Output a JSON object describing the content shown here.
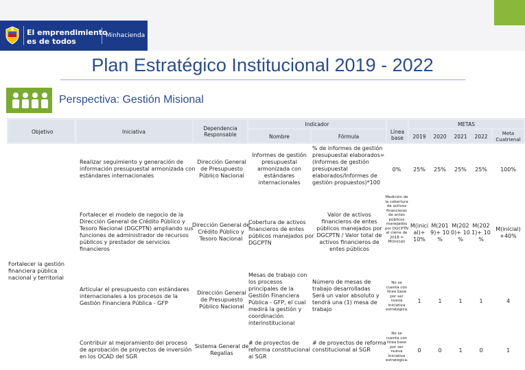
{
  "brand": {
    "line1": "El emprendimiento",
    "line2": "es de todos",
    "ministry": "Minhacienda",
    "bar_color": "#1b3a8a",
    "accent_color": "#8ab83a"
  },
  "title": "Plan Estratégico Institucional 2019 - 2022",
  "perspective": "Perspectiva: Gestión Misional",
  "headers": {
    "objetivo": "Objetivo",
    "iniciativa": "Iniciativa",
    "dependencia": "Dependencia Responsable",
    "indicador": "Indicador",
    "nombre": "Nombre",
    "formula": "Fórmula",
    "linea_base": "Línea base",
    "metas": "METAS",
    "years": [
      "2019",
      "2020",
      "2021",
      "2022"
    ],
    "meta_cuatrienal": "Meta Cuatrienal"
  },
  "objetivo": "Fortalecer la gestión financiera pública nacional y territorial",
  "rows": [
    {
      "iniciativa": "Realizar seguimiento y generación de información presupuestal armonizada con estándares internacionales",
      "dependencia": "Dirección General de Presupuesto Público Nacional",
      "nombre": "Informes de gestión presupuestal armonizada con estándares internacionales",
      "formula": "% de informes de gestión presupuestal elaborados=(Informes de gestión presupuestal elaborados/Informes de gestión propuestos)*100",
      "linea_base": "0%",
      "metas": [
        "25%",
        "25%",
        "25%",
        "25%"
      ],
      "cuatrienal": "100%"
    },
    {
      "iniciativa": "Fortalecer el modelo de negocio de la Dirección General de Crédito Público y Tesoro Nacional (DGCPTN) ampliando sus funciones de administrador de recursos públicos y prestador de servicios financieros",
      "dependencia": "Dirección General de Crédito Público y Tesoro Nacional",
      "nombre": "Cobertura de activos financieros de entes públicos manejados por DGCPTN",
      "formula": "Valor de activos financieros de entes públicos manejados por DGCPTN / Valor total de activos financieros de entes públicos",
      "linea_base": "Medición de la cobertura de activos financieros de entes públicos manejados por DGCPTN al cierre de 2018 = M(inicial)",
      "metas": [
        "M(inici al)+ 10%",
        "M(201 9)+ 10 %",
        "M(202 0)+ 10 %",
        "M(202 1)+ 10 %"
      ],
      "cuatrienal": "M(inicial) +40%"
    },
    {
      "iniciativa": "Articular el presupuesto con estándares internacionales a los procesos de la Gestión Financiera Pública - GFP",
      "dependencia": "Dirección General de Presupuesto Público Nacional",
      "nombre": "Mesas de trabajo con los procesos principales de la Gestión Financiera Pública - GFP, el cual medirá la gestión y coordinación interinstitucional",
      "formula": "Número de mesas de trabajo desarrolladas  Será un valor absoluto y tendrá una (1) mesa de trabajo",
      "linea_base": "No se cuenta con línea base por ser nueva iniciativa estratégica.",
      "metas": [
        "1",
        "1",
        "1",
        "1"
      ],
      "cuatrienal": "4"
    },
    {
      "iniciativa": "Contribuir al mejoramiento del proceso de aprobación de proyectos de inversión en los OCAD del SGR",
      "dependencia": "Sistema General de Regalías",
      "nombre": "# de proyectos de reforma constitucional al SGR",
      "formula": "# de proyectos de reforma constitucional al SGR",
      "linea_base": "No se cuenta con línea base por ser nueva iniciativa estratégica.",
      "metas": [
        "0",
        "0",
        "1",
        "0"
      ],
      "cuatrienal": "1"
    }
  ]
}
